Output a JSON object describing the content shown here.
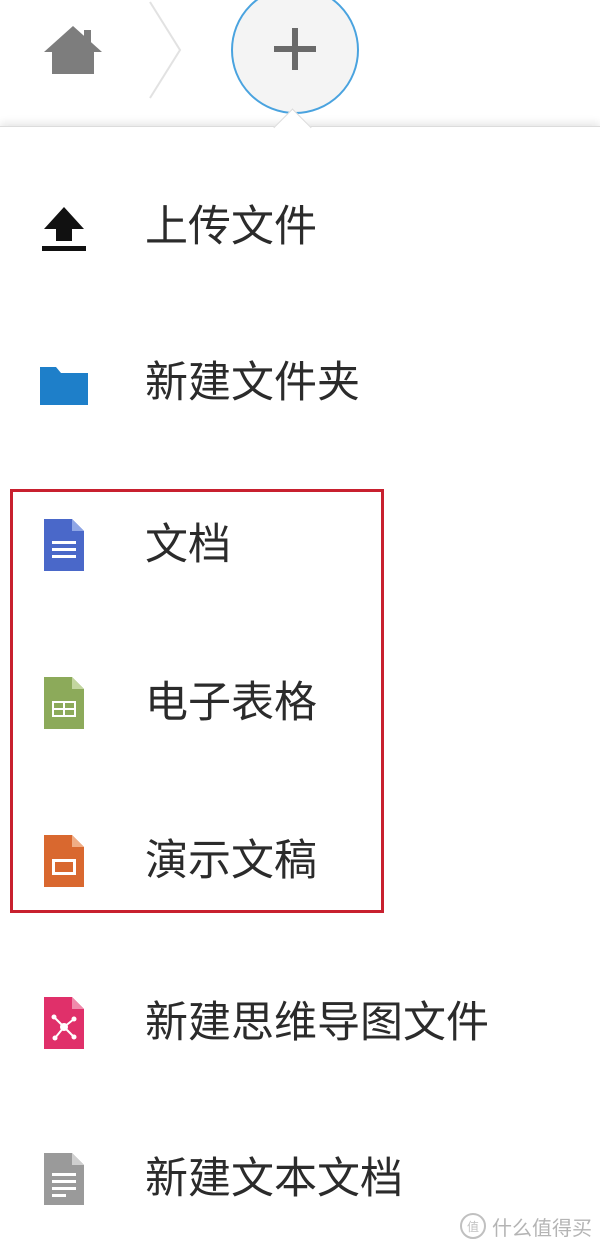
{
  "toolbar": {
    "home_icon": "home-icon",
    "separator_icon": "chevron-right-icon",
    "add_icon": "plus-icon",
    "add_ring_color": "#4aa3df"
  },
  "menu": {
    "items": [
      {
        "label": "上传文件",
        "icon": "upload-icon",
        "color": "#111111"
      },
      {
        "label": "新建文件夹",
        "icon": "folder-icon",
        "color": "#1e7fc9"
      },
      {
        "label": "文档",
        "icon": "document-icon",
        "color": "#4a68c9"
      },
      {
        "label": "电子表格",
        "icon": "spreadsheet-icon",
        "color": "#8caa5a"
      },
      {
        "label": "演示文稿",
        "icon": "presentation-icon",
        "color": "#d9682f"
      },
      {
        "label": "新建思维导图文件",
        "icon": "mindmap-icon",
        "color": "#e0306a"
      },
      {
        "label": "新建文本文档",
        "icon": "text-file-icon",
        "color": "#9a9a9a"
      }
    ],
    "highlight_color": "#c8202f"
  },
  "watermark": {
    "text": "什么值得买",
    "logo_glyph": "值"
  }
}
